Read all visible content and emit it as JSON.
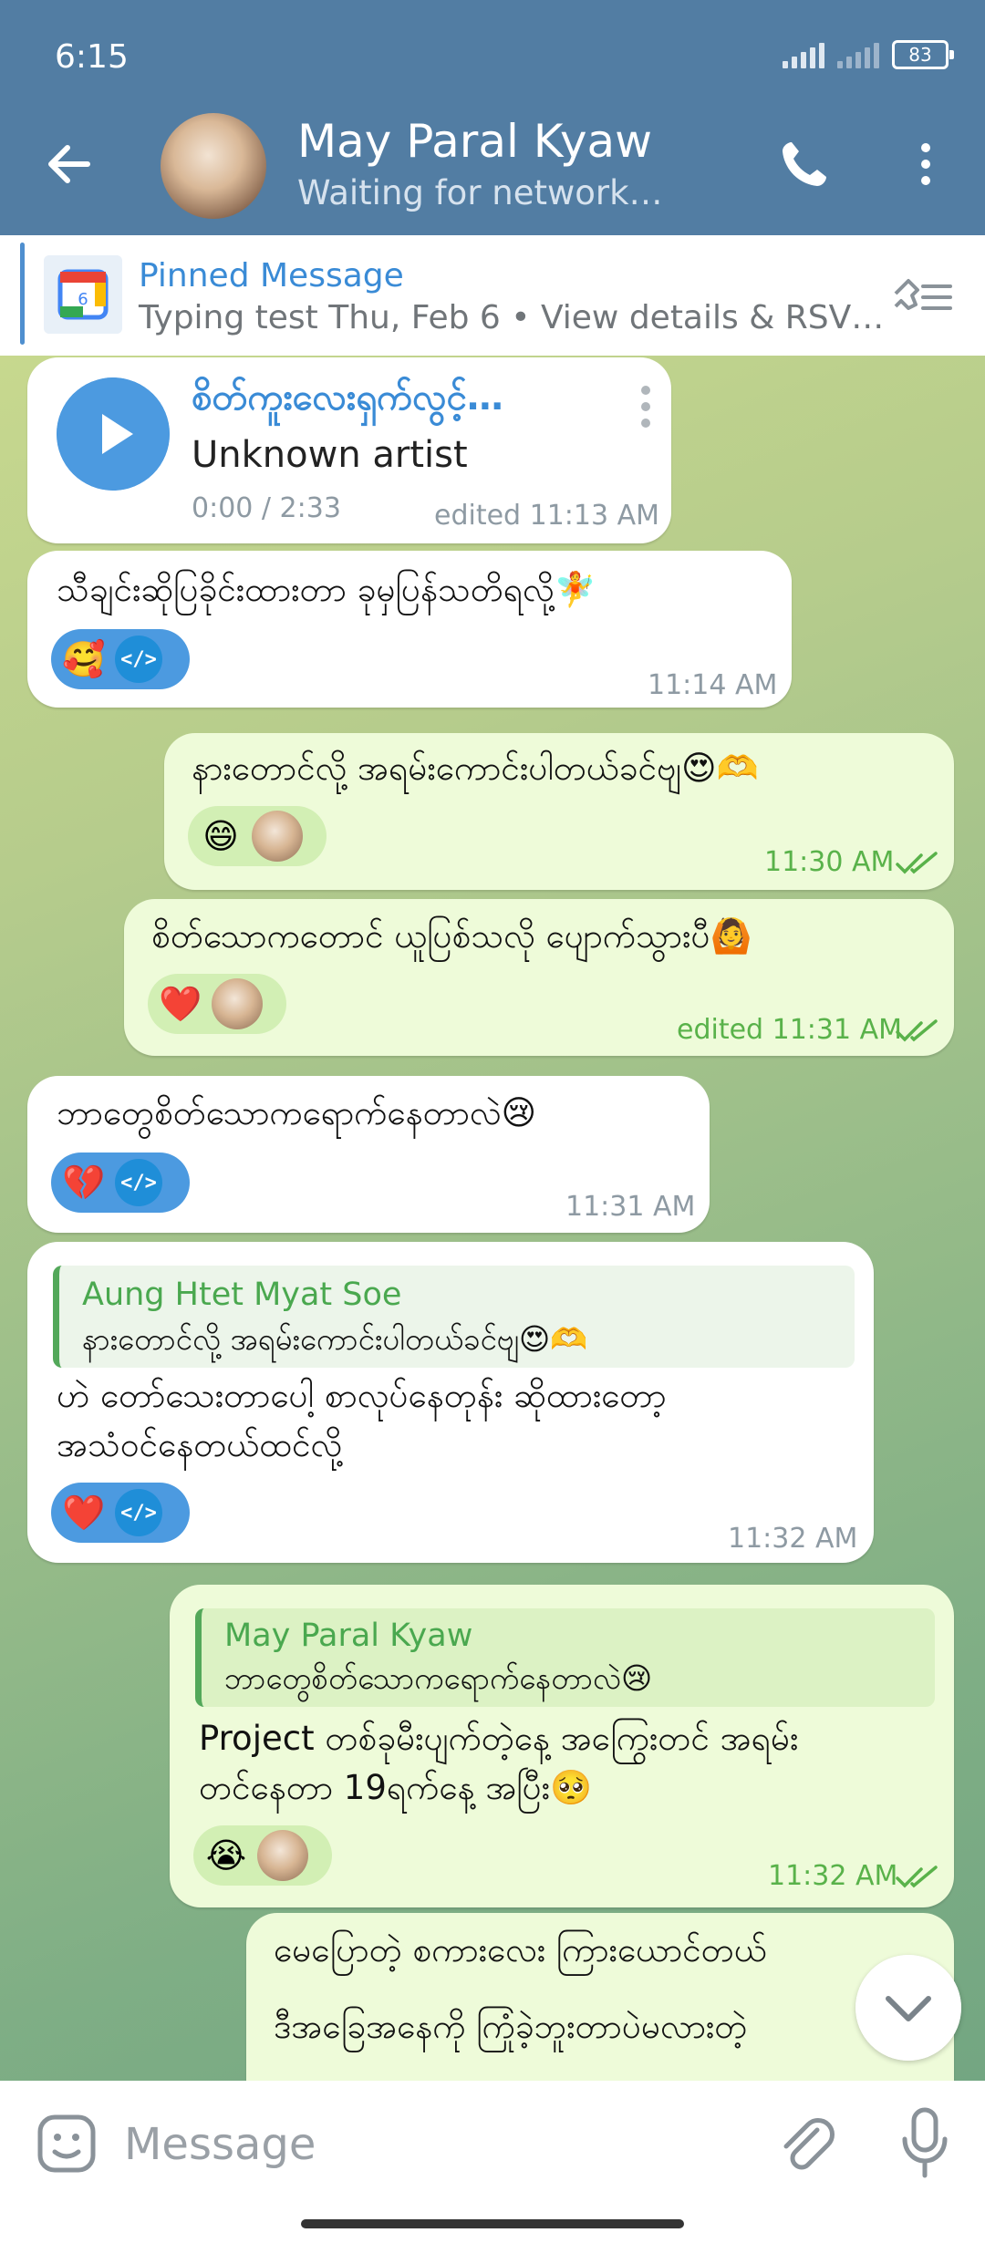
{
  "status_bar": {
    "time": "6:15",
    "battery": "83"
  },
  "header": {
    "contact_name": "May Paral Kyaw",
    "contact_status": "Waiting for network…"
  },
  "pinned": {
    "title": "Pinned Message",
    "text": "Typing test Thu, Feb 6 • View details & RSV…"
  },
  "messages": {
    "audio": {
      "title": "စိတ်ကူးလေးရှက်လွင့်…",
      "artist": "Unknown artist",
      "progress": "0:00 / 2:33",
      "time": "edited 11:13 AM"
    },
    "m1": {
      "text": "သီချင်းဆိုပြခိုင်းထားတာ ခုမှပြန်သတိရလို့🧚",
      "reaction": "🥰",
      "time": "11:14 AM"
    },
    "m2": {
      "text": "နားတောင်လို့ အရမ်းကောင်းပါတယ်ခင်ဗျ😍🫶",
      "reaction": "😄",
      "time": "11:30 AM"
    },
    "m3": {
      "text": "စိတ်သောကတောင် ယူပြစ်သလို ပျောက်သွားပီ🙆",
      "reaction": "❤️",
      "time": "edited 11:31 AM"
    },
    "m4": {
      "text": "ဘာတွေစိတ်သောကရောက်နေတာလဲ😢",
      "reaction": "💔",
      "time": "11:31 AM"
    },
    "m5": {
      "quote_name": "Aung Htet Myat Soe",
      "quote_text": "နားတောင်လို့ အရမ်းကောင်းပါတယ်ခင်ဗျ😍🫶",
      "line1": "ဟဲ တော်သေးတာပေါ့ စာလုပ်နေတုန်း ဆိုထားတော့",
      "line2": "အသံဝင်နေတယ်ထင်လို့",
      "reaction": "❤️",
      "time": "11:32 AM"
    },
    "m6": {
      "quote_name": "May Paral Kyaw",
      "quote_text": "ဘာတွေစိတ်သောကရောက်နေတာလဲ😢",
      "line1": "Project တစ်ခုမီးပျက်တဲ့နေ့ အကြွေးတင် အရမ်း",
      "line2": "တင်နေတာ 19ရက်နေ့ အပြီး🥺",
      "reaction": "😭",
      "time": "11:32 AM"
    },
    "m7": {
      "line1": "မေပြောတဲ့ စကားလေး ကြားယောင်တယ်",
      "line2": "ဒီအခြေအနေကို ကြုံခဲ့ဘူးတာပဲမလားတဲ့"
    }
  },
  "input": {
    "placeholder": "Message"
  },
  "colors": {
    "header": "#527da3",
    "incoming": "#ffffff",
    "outgoing": "#eefbd9",
    "accent": "#4c9ae0",
    "time_out": "#59b24a"
  },
  "icons": [
    "back-arrow-icon",
    "phone-icon",
    "more-vert-icon",
    "pin-list-icon",
    "play-icon",
    "emoji-icon",
    "attach-icon",
    "mic-icon",
    "chevron-down-icon",
    "double-check-icon"
  ]
}
